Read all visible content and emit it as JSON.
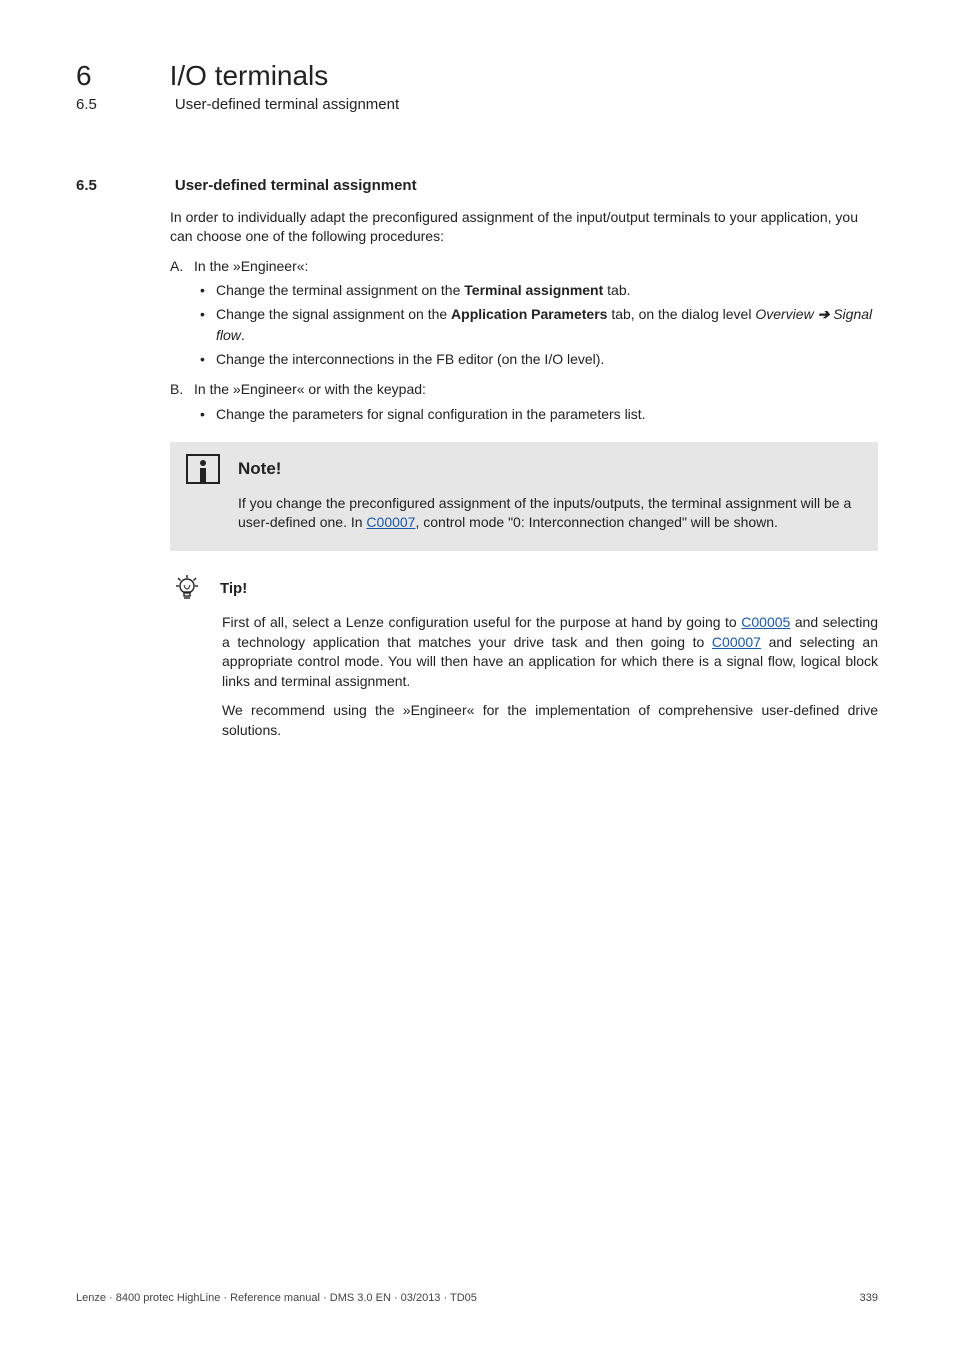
{
  "chapter": {
    "number": "6",
    "title": "I/O terminals"
  },
  "subheader": {
    "number": "6.5",
    "title": "User-defined terminal assignment"
  },
  "separator": "_ _ _ _ _ _ _ _ _ _ _ _ _ _ _ _ _ _ _ _ _ _ _ _ _ _ _ _ _ _ _ _ _ _ _ _ _ _ _ _ _ _ _ _ _ _ _ _ _ _ _ _ _ _ _ _ _ _ _ _ _ _ _ _",
  "section": {
    "number": "6.5",
    "title": "User-defined terminal assignment"
  },
  "intro": "In order to individually adapt the preconfigured assignment of the input/output terminals to your application, you can choose one of the following procedures:",
  "listA": {
    "letter": "A.",
    "text": "In the »Engineer«:",
    "bullets": [
      {
        "pre": "Change the terminal assignment on the ",
        "bold": "Terminal assignment",
        "post": " tab."
      },
      {
        "pre": "Change the signal assignment on the ",
        "bold": "Application Parameters",
        "post": " tab, on the dialog level ",
        "italic1": "Overview",
        "arrow": " ➔ ",
        "italic2": "Signal flow",
        "post2": "."
      },
      {
        "pre": "Change the interconnections in the FB editor (on the I/O level).",
        "bold": "",
        "post": ""
      }
    ]
  },
  "listB": {
    "letter": "B.",
    "text": "In the »Engineer« or with the keypad:",
    "bullets": [
      {
        "pre": "Change the parameters for signal configuration in the parameters list.",
        "bold": "",
        "post": ""
      }
    ]
  },
  "note": {
    "title": "Note!",
    "body_pre": "If you change the preconfigured assignment of the inputs/outputs, the terminal assignment will be a user-defined one. In ",
    "link": "C00007",
    "body_post": ", control mode \"0: Interconnection changed\" will be shown."
  },
  "tip": {
    "title": "Tip!",
    "p1_pre": "First of all, select a Lenze configuration useful for the purpose at hand by going to ",
    "link1": "C00005",
    "p1_mid": " and selecting a technology application that matches your drive task and then going to ",
    "link2": "C00007",
    "p1_post": " and selecting an appropriate control mode. You will then have an application for which there is a signal flow, logical block links and terminal assignment.",
    "p2": "We recommend using the »Engineer« for the implementation of comprehensive user-defined drive solutions."
  },
  "footer": {
    "left": "Lenze · 8400 protec HighLine · Reference manual · DMS 3.0 EN · 03/2013 · TD05",
    "right": "339"
  }
}
